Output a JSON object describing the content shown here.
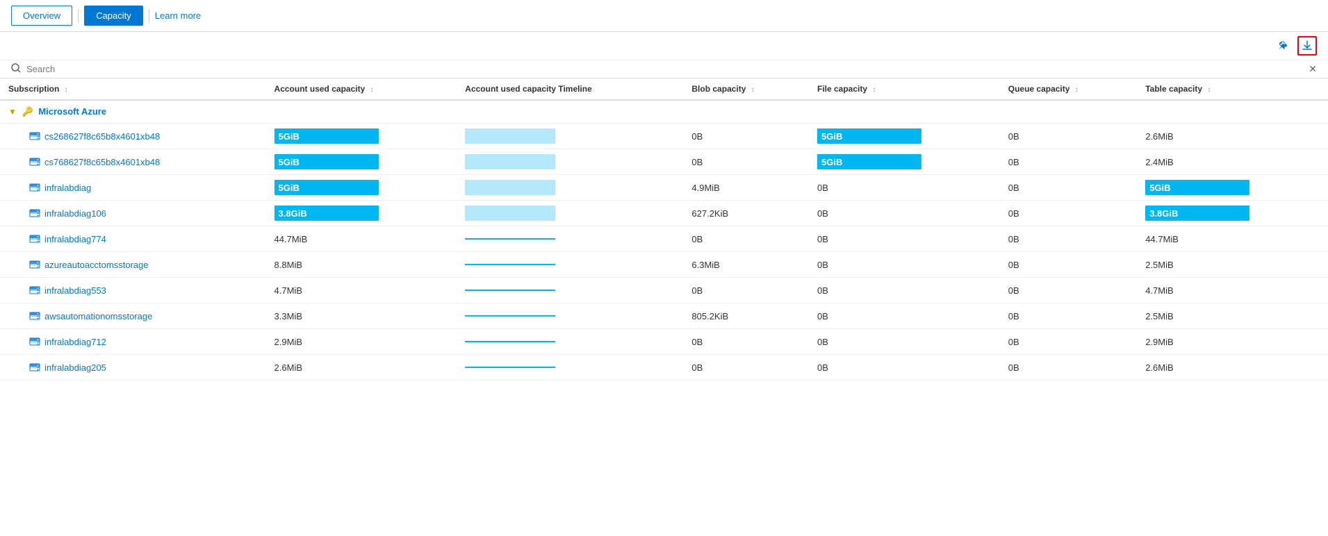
{
  "nav": {
    "overview_label": "Overview",
    "capacity_label": "Capacity",
    "learn_more_label": "Learn more"
  },
  "toolbar": {
    "pin_icon": "📌",
    "download_icon": "⬇"
  },
  "search": {
    "placeholder": "Search",
    "clear_icon": "✕"
  },
  "table": {
    "columns": [
      {
        "key": "subscription",
        "label": "Subscription"
      },
      {
        "key": "account_used",
        "label": "Account used capacity"
      },
      {
        "key": "account_timeline",
        "label": "Account used capacity Timeline"
      },
      {
        "key": "blob",
        "label": "Blob capacity"
      },
      {
        "key": "file",
        "label": "File capacity"
      },
      {
        "key": "queue",
        "label": "Queue capacity"
      },
      {
        "key": "table_cap",
        "label": "Table capacity"
      }
    ],
    "group": {
      "name": "Microsoft Azure"
    },
    "rows": [
      {
        "name": "cs268627f8c65b8x4601xb48",
        "account_used": {
          "type": "bar",
          "label": "5GiB"
        },
        "account_timeline": {
          "type": "timeline_light"
        },
        "blob": {
          "type": "plain",
          "label": "0B"
        },
        "file": {
          "type": "bar",
          "label": "5GiB"
        },
        "queue": {
          "type": "plain",
          "label": "0B"
        },
        "table_cap": {
          "type": "plain",
          "label": "2.6MiB"
        }
      },
      {
        "name": "cs768627f8c65b8x4601xb48",
        "account_used": {
          "type": "bar",
          "label": "5GiB"
        },
        "account_timeline": {
          "type": "timeline_light"
        },
        "blob": {
          "type": "plain",
          "label": "0B"
        },
        "file": {
          "type": "bar",
          "label": "5GiB"
        },
        "queue": {
          "type": "plain",
          "label": "0B"
        },
        "table_cap": {
          "type": "plain",
          "label": "2.4MiB"
        }
      },
      {
        "name": "infralabdiag",
        "account_used": {
          "type": "bar",
          "label": "5GiB"
        },
        "account_timeline": {
          "type": "timeline_light"
        },
        "blob": {
          "type": "plain",
          "label": "4.9MiB"
        },
        "file": {
          "type": "plain",
          "label": "0B"
        },
        "queue": {
          "type": "plain",
          "label": "0B"
        },
        "table_cap": {
          "type": "bar_right",
          "label": "5GiB"
        }
      },
      {
        "name": "infralabdiag106",
        "account_used": {
          "type": "bar",
          "label": "3.8GiB"
        },
        "account_timeline": {
          "type": "timeline_light"
        },
        "blob": {
          "type": "plain",
          "label": "627.2KiB"
        },
        "file": {
          "type": "plain",
          "label": "0B"
        },
        "queue": {
          "type": "plain",
          "label": "0B"
        },
        "table_cap": {
          "type": "bar_right",
          "label": "3.8GiB"
        }
      },
      {
        "name": "infralabdiag774",
        "account_used": {
          "type": "plain",
          "label": "44.7MiB"
        },
        "account_timeline": {
          "type": "timeline_line"
        },
        "blob": {
          "type": "plain",
          "label": "0B"
        },
        "file": {
          "type": "plain",
          "label": "0B"
        },
        "queue": {
          "type": "plain",
          "label": "0B"
        },
        "table_cap": {
          "type": "plain",
          "label": "44.7MiB"
        }
      },
      {
        "name": "azureautoacctomsstorage",
        "account_used": {
          "type": "plain",
          "label": "8.8MiB"
        },
        "account_timeline": {
          "type": "timeline_line"
        },
        "blob": {
          "type": "plain",
          "label": "6.3MiB"
        },
        "file": {
          "type": "plain",
          "label": "0B"
        },
        "queue": {
          "type": "plain",
          "label": "0B"
        },
        "table_cap": {
          "type": "plain",
          "label": "2.5MiB"
        }
      },
      {
        "name": "infralabdiag553",
        "account_used": {
          "type": "plain",
          "label": "4.7MiB"
        },
        "account_timeline": {
          "type": "timeline_line"
        },
        "blob": {
          "type": "plain",
          "label": "0B"
        },
        "file": {
          "type": "plain",
          "label": "0B"
        },
        "queue": {
          "type": "plain",
          "label": "0B"
        },
        "table_cap": {
          "type": "plain",
          "label": "4.7MiB"
        }
      },
      {
        "name": "awsautomationomsstorage",
        "account_used": {
          "type": "plain",
          "label": "3.3MiB"
        },
        "account_timeline": {
          "type": "timeline_line"
        },
        "blob": {
          "type": "plain",
          "label": "805.2KiB"
        },
        "file": {
          "type": "plain",
          "label": "0B"
        },
        "queue": {
          "type": "plain",
          "label": "0B"
        },
        "table_cap": {
          "type": "plain",
          "label": "2.5MiB"
        }
      },
      {
        "name": "infralabdiag712",
        "account_used": {
          "type": "plain",
          "label": "2.9MiB"
        },
        "account_timeline": {
          "type": "timeline_line"
        },
        "blob": {
          "type": "plain",
          "label": "0B"
        },
        "file": {
          "type": "plain",
          "label": "0B"
        },
        "queue": {
          "type": "plain",
          "label": "0B"
        },
        "table_cap": {
          "type": "plain",
          "label": "2.9MiB"
        }
      },
      {
        "name": "infralabdiag205",
        "account_used": {
          "type": "plain",
          "label": "2.6MiB"
        },
        "account_timeline": {
          "type": "timeline_line"
        },
        "blob": {
          "type": "plain",
          "label": "0B"
        },
        "file": {
          "type": "plain",
          "label": "0B"
        },
        "queue": {
          "type": "plain",
          "label": "0B"
        },
        "table_cap": {
          "type": "plain",
          "label": "2.6MiB"
        }
      }
    ]
  }
}
